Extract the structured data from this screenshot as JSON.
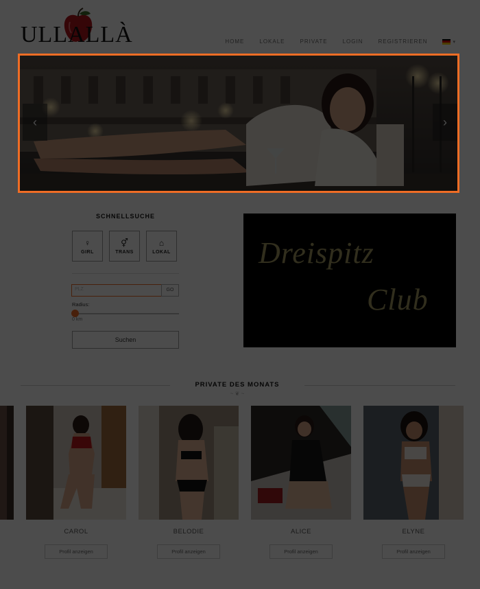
{
  "header": {
    "logo_text": "ULLALLÀ",
    "nav": [
      "HOME",
      "LOKALE",
      "PRIVATE",
      "LOGIN",
      "REGISTRIEREN"
    ],
    "language_flag": "flag-de-icon"
  },
  "slider": {
    "prev_icon": "chevron-left-icon",
    "next_icon": "chevron-right-icon"
  },
  "quick_search": {
    "title": "SCHNELLSUCHE",
    "buttons": [
      {
        "label": "GIRL",
        "icon": "female-symbol-icon",
        "glyph": "♀"
      },
      {
        "label": "TRANS",
        "icon": "trans-symbol-icon",
        "glyph": "⚥"
      },
      {
        "label": "LOKAL",
        "icon": "home-icon",
        "glyph": "⌂"
      }
    ],
    "plz_placeholder": "PLZ",
    "go_label": "GO",
    "radius_label": "Radius:",
    "radius_value": "0 km",
    "search_label": "Suchen"
  },
  "club_banner": {
    "line1": "Dreispitz",
    "line2": "Club"
  },
  "private_des_monats": {
    "title": "PRIVATE DES MONATS",
    "profiles": [
      {
        "name": "CAROL",
        "button": "Profil anzeigen"
      },
      {
        "name": "BELODIE",
        "button": "Profil anzeigen"
      },
      {
        "name": "ALICE",
        "button": "Profil anzeigen"
      },
      {
        "name": "ELYNE",
        "button": "Profil anzeigen"
      }
    ]
  },
  "colors": {
    "accent": "#f06d25",
    "club_gold": "#a59a63",
    "overlay": "rgba(0,0,0,0.70)"
  }
}
